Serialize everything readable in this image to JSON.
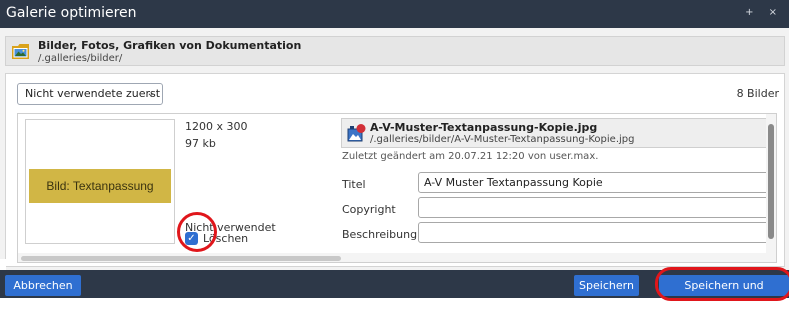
{
  "window": {
    "title": "Galerie optimieren",
    "controls": "+ ×"
  },
  "folder": {
    "name": "Bilder, Fotos, Grafiken von Dokumentation",
    "path": "/.galleries/bilder/",
    "icon": "image-folder-icon"
  },
  "toolbar": {
    "sort_selected": "Nicht verwendete zuerst",
    "count": "8 Bilder"
  },
  "image": {
    "preview_text": "Bild: Textanpassung",
    "dimensions": "1200 x 300",
    "size": "97 kb",
    "status": "Nicht verwendet",
    "delete_label": "Löschen",
    "delete_checked": true,
    "file_name": "A-V-Muster-Textanpassung-Kopie.jpg",
    "file_path": "/.galleries/bilder/A-V-Muster-Textanpassung-Kopie.jpg",
    "modified": "Zuletzt geändert am 20.07.21 12:20 von user.max.",
    "fields": {
      "title_label": "Titel",
      "title_value": "A-V Muster Textanpassung Kopie",
      "copyright_label": "Copyright",
      "copyright_value": "",
      "description_label": "Beschreibung",
      "description_value": ""
    }
  },
  "footer": {
    "cancel_label": "Abbrechen",
    "save_label": "Speichern",
    "save_close_label": "Speichern und schließen"
  },
  "colors": {
    "titlebar": "#2d3848",
    "button": "#2f6fd1",
    "highlight": "#e0161b",
    "preview_bg": "#d1b645"
  }
}
